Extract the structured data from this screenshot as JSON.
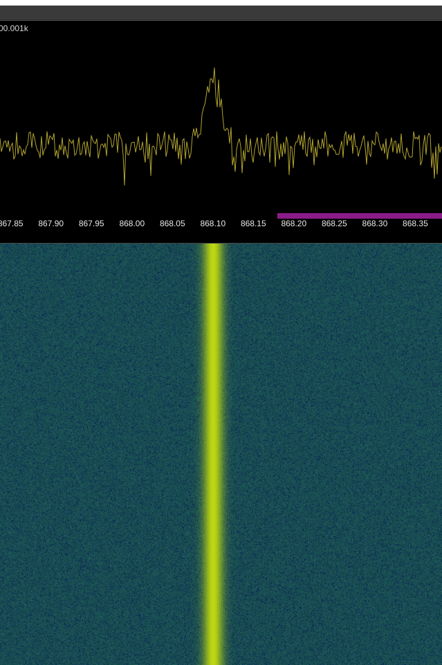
{
  "header": {
    "resolution_label": "00.001k"
  },
  "frequency_axis": {
    "unit": "MHz",
    "tick_labels": [
      "867.85",
      "867.90",
      "867.95",
      "868.00",
      "868.05",
      "868.10",
      "868.15",
      "868.20",
      "868.25",
      "868.30",
      "868.35"
    ],
    "view_range_mhz": [
      867.837,
      868.383
    ],
    "tick_start_mhz": 867.85,
    "tick_step_mhz": 0.05
  },
  "band_marker": {
    "start_mhz": 868.18,
    "end_mhz": 868.383,
    "color": "#8a1c8a"
  },
  "spectrum": {
    "trace_color": "#b3a52f",
    "background_color": "#000000",
    "peak_mhz": 868.1,
    "noise_floor_level": 0.38,
    "peak_level": 0.78
  },
  "waterfall": {
    "signal_center_mhz": 868.1,
    "signal_color": "#c8cf10",
    "background_color": "#124a4c"
  },
  "colors": {
    "toolbar_bg": "#3a3a3a",
    "panel_bg": "#000000",
    "label_text": "#e8e8e8"
  }
}
